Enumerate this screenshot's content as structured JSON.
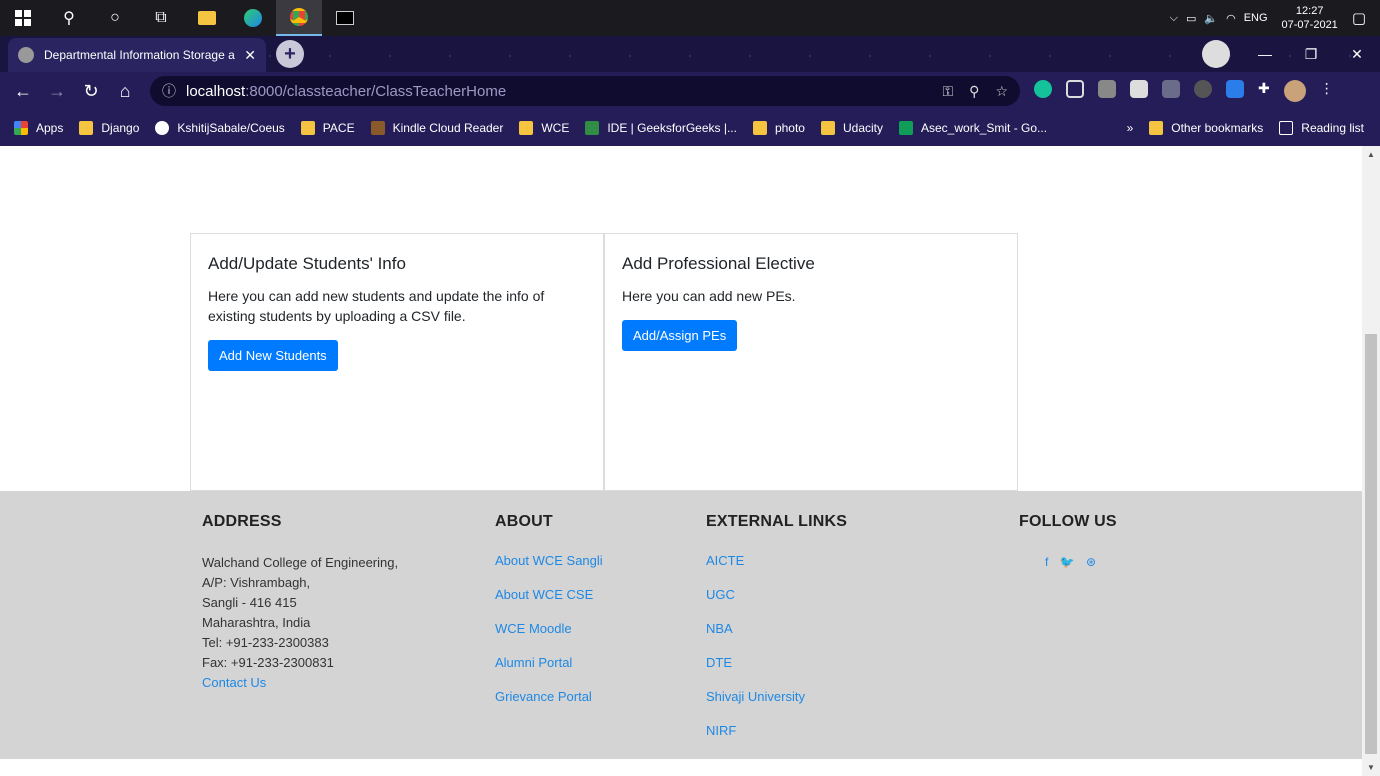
{
  "taskbar": {
    "tray_lang": "ENG",
    "time": "12:27",
    "date": "07-07-2021"
  },
  "browser": {
    "tab_title": "Departmental Information Storage a",
    "url_host": "localhost",
    "url_path": ":8000/classteacher/ClassTeacherHome",
    "bookmarks": [
      "Apps",
      "Django",
      "KshitijSabale/Coeus",
      "PACE",
      "Kindle Cloud Reader",
      "WCE",
      "IDE | GeeksforGeeks |...",
      "photo",
      "Udacity",
      "Asec_work_Smit - Go..."
    ],
    "bookmarks_overflow": "»",
    "other_bookmarks": "Other bookmarks",
    "reading_list": "Reading list"
  },
  "cards": [
    {
      "title": "Add/Update Students' Info",
      "text": "Here you can add new students and update the info of existing students by uploading a CSV file.",
      "button": "Add New Students"
    },
    {
      "title": "Add Professional Elective",
      "text": "Here you can add new PEs.",
      "button": "Add/Assign PEs"
    }
  ],
  "footer": {
    "address": {
      "heading": "ADDRESS",
      "lines": [
        "Walchand College of Engineering,",
        "A/P: Vishrambagh,",
        "Sangli - 416 415",
        "Maharashtra, India",
        "Tel: +91-233-2300383",
        "Fax: +91-233-2300831"
      ],
      "contact": "Contact Us"
    },
    "about": {
      "heading": "ABOUT",
      "links": [
        "About WCE Sangli",
        "About WCE CSE",
        "WCE Moodle",
        "Alumni Portal",
        "Grievance Portal"
      ]
    },
    "external": {
      "heading": "EXTERNAL LINKS",
      "links": [
        "AICTE",
        "UGC",
        "NBA",
        "DTE",
        "Shivaji University",
        "NIRF"
      ]
    },
    "follow": {
      "heading": "FOLLOW US",
      "icons": "f 🐦 ⊛"
    }
  },
  "colors": {
    "primary": "#007bff",
    "link": "#1e88e5",
    "footer_bg": "#d4d4d4"
  }
}
